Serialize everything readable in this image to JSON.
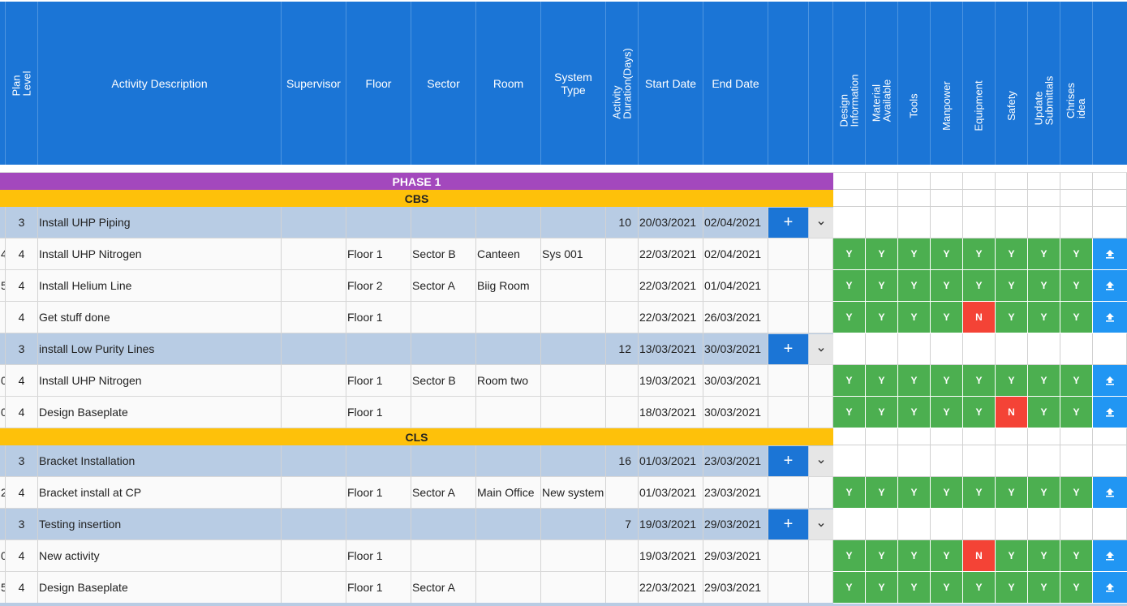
{
  "header": {
    "plan_level": [
      "Plan",
      "Level"
    ],
    "activity_description": "Activity Description",
    "supervisor": "Supervisor",
    "floor": "Floor",
    "sector": "Sector",
    "room": "Room",
    "system_type": "System Type",
    "duration": [
      "Activity",
      "Duration(Days)"
    ],
    "start_date": "Start Date",
    "end_date": "End Date",
    "flags": [
      [
        "Design",
        "Information"
      ],
      [
        "Material",
        "Available"
      ],
      [
        "Tools"
      ],
      [
        "Manpower"
      ],
      [
        "Equipment"
      ],
      [
        "Safety"
      ],
      [
        "Update",
        "Submittals"
      ],
      [
        "Chrises",
        "idea"
      ]
    ]
  },
  "bands": {
    "phase1": "PHASE 1",
    "cbs": "CBS",
    "cls": "CLS"
  },
  "buttons": {
    "add": "+"
  },
  "rows": [
    {
      "type": "parent",
      "id": "",
      "level": "3",
      "desc": "Install UHP Piping",
      "supervisor": "",
      "floor": "",
      "sector": "",
      "room": "",
      "system": "",
      "duration": "10",
      "start": "20/03/2021",
      "end": "02/04/2021"
    },
    {
      "type": "child",
      "id": "4",
      "level": "4",
      "desc": "Install UHP Nitrogen",
      "supervisor": "",
      "floor": "Floor 1",
      "sector": "Sector B",
      "room": "Canteen",
      "system": "Sys 001",
      "duration": "",
      "start": "22/03/2021",
      "end": "02/04/2021",
      "flags": [
        "Y",
        "Y",
        "Y",
        "Y",
        "Y",
        "Y",
        "Y",
        "Y"
      ]
    },
    {
      "type": "child",
      "id": "5",
      "level": "4",
      "desc": "Install Helium Line",
      "supervisor": "",
      "floor": "Floor 2",
      "sector": "Sector A",
      "room": "Biig Room",
      "system": "",
      "duration": "",
      "start": "22/03/2021",
      "end": "01/04/2021",
      "flags": [
        "Y",
        "Y",
        "Y",
        "Y",
        "Y",
        "Y",
        "Y",
        "Y"
      ]
    },
    {
      "type": "child",
      "id": "",
      "level": "4",
      "desc": "Get stuff done",
      "supervisor": "",
      "floor": "Floor 1",
      "sector": "",
      "room": "",
      "system": "",
      "duration": "",
      "start": "22/03/2021",
      "end": "26/03/2021",
      "flags": [
        "Y",
        "Y",
        "Y",
        "Y",
        "N",
        "Y",
        "Y",
        "Y"
      ]
    },
    {
      "type": "parent",
      "id": "",
      "level": "3",
      "desc": "install Low Purity Lines",
      "supervisor": "",
      "floor": "",
      "sector": "",
      "room": "",
      "system": "",
      "duration": "12",
      "start": "13/03/2021",
      "end": "30/03/2021"
    },
    {
      "type": "child",
      "id": "0",
      "level": "4",
      "desc": "Install UHP Nitrogen",
      "supervisor": "",
      "floor": "Floor 1",
      "sector": "Sector B",
      "room": "Room two",
      "system": "",
      "duration": "",
      "start": "19/03/2021",
      "end": "30/03/2021",
      "flags": [
        "Y",
        "Y",
        "Y",
        "Y",
        "Y",
        "Y",
        "Y",
        "Y"
      ]
    },
    {
      "type": "child",
      "id": "0",
      "level": "4",
      "desc": "Design Baseplate",
      "supervisor": "",
      "floor": "Floor 1",
      "sector": "",
      "room": "",
      "system": "",
      "duration": "",
      "start": "18/03/2021",
      "end": "30/03/2021",
      "flags": [
        "Y",
        "Y",
        "Y",
        "Y",
        "Y",
        "N",
        "Y",
        "Y"
      ]
    },
    {
      "type": "parent",
      "id": "",
      "level": "3",
      "desc": "Bracket Installation",
      "supervisor": "",
      "floor": "",
      "sector": "",
      "room": "",
      "system": "",
      "duration": "16",
      "start": "01/03/2021",
      "end": "23/03/2021"
    },
    {
      "type": "child",
      "id": "2",
      "level": "4",
      "desc": "Bracket install at CP",
      "supervisor": "",
      "floor": "Floor 1",
      "sector": "Sector A",
      "room": "Main Office",
      "system": "New system",
      "duration": "",
      "start": "01/03/2021",
      "end": "23/03/2021",
      "flags": [
        "Y",
        "Y",
        "Y",
        "Y",
        "Y",
        "Y",
        "Y",
        "Y"
      ]
    },
    {
      "type": "parent",
      "id": "",
      "level": "3",
      "desc": "Testing insertion",
      "supervisor": "",
      "floor": "",
      "sector": "",
      "room": "",
      "system": "",
      "duration": "7",
      "start": "19/03/2021",
      "end": "29/03/2021"
    },
    {
      "type": "child",
      "id": "0",
      "level": "4",
      "desc": "New activity",
      "supervisor": "",
      "floor": "Floor 1",
      "sector": "",
      "room": "",
      "system": "",
      "duration": "",
      "start": "19/03/2021",
      "end": "29/03/2021",
      "flags": [
        "Y",
        "Y",
        "Y",
        "Y",
        "N",
        "Y",
        "Y",
        "Y"
      ]
    },
    {
      "type": "child",
      "id": "5",
      "level": "4",
      "desc": "Design Baseplate",
      "supervisor": "",
      "floor": "Floor 1",
      "sector": "Sector A",
      "room": "",
      "system": "",
      "duration": "",
      "start": "22/03/2021",
      "end": "29/03/2021",
      "flags": [
        "Y",
        "Y",
        "Y",
        "Y",
        "Y",
        "Y",
        "Y",
        "Y"
      ]
    }
  ],
  "colors": {
    "header_bg": "#1b75d6",
    "phase_band": "#a348bd",
    "section_band": "#fec10a",
    "parent_row": "#b8cce4",
    "flag_yes": "#4caf50",
    "flag_no": "#f44336",
    "upload_button": "#2196f3"
  },
  "icons": {
    "add": "plus-icon",
    "expand": "chevron-down-icon",
    "upload": "upload-arrow-icon"
  }
}
